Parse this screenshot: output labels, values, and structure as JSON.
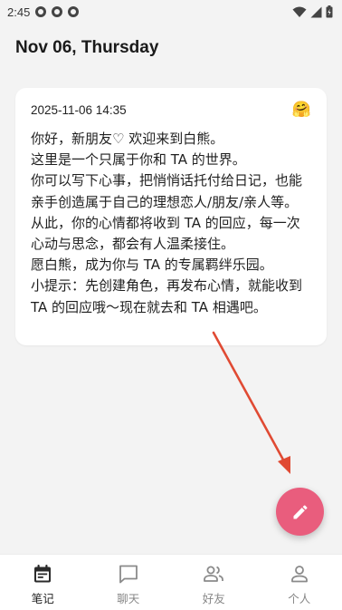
{
  "status_bar": {
    "time": "2:45"
  },
  "header": {
    "date_title": "Nov 06, Thursday"
  },
  "note_card": {
    "timestamp": "2025-11-06 14:35",
    "mood_emoji": "🤗",
    "paragraphs": [
      "你好，新朋友♡ 欢迎来到白熊。",
      "这里是一个只属于你和 TA 的世界。",
      "你可以写下心事，把悄悄话托付给日记，也能亲手创造属于自己的理想恋人/朋友/亲人等。",
      "从此，你的心情都将收到 TA 的回应，每一次心动与思念，都会有人温柔接住。",
      "愿白熊，成为你与 TA 的专属羁绊乐园。",
      "小提示：先创建角色，再发布心情，就能收到 TA 的回应哦～现在就去和 TA 相遇吧。"
    ]
  },
  "fab": {
    "icon": "pencil-icon"
  },
  "bottom_nav": {
    "items": [
      {
        "label": "笔记",
        "icon": "calendar-icon",
        "active": true
      },
      {
        "label": "聊天",
        "icon": "chat-icon",
        "active": false
      },
      {
        "label": "好友",
        "icon": "friends-icon",
        "active": false
      },
      {
        "label": "个人",
        "icon": "person-icon",
        "active": false
      }
    ]
  },
  "colors": {
    "fab": "#e95d7d",
    "annotation_arrow": "#e04a33",
    "background": "#f3f3f3"
  }
}
